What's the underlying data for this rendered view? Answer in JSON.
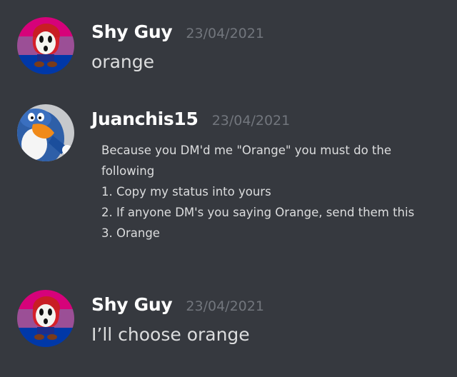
{
  "messages": [
    {
      "username": "Shy Guy",
      "timestamp": "23/04/2021",
      "text": "orange"
    },
    {
      "username": "Juanchis15",
      "timestamp": "23/04/2021",
      "lines": [
        "Because you DM'd me \"Orange\" you must do the",
        "following",
        "1. Copy my status into yours",
        "2. If anyone DM's you saying Orange, send them this",
        "3. Orange"
      ]
    },
    {
      "username": "Shy Guy",
      "timestamp": "23/04/2021",
      "text": "I’ll choose orange"
    }
  ],
  "colors": {
    "background": "#36393f",
    "username": "#ffffff",
    "timestamp": "#72767d",
    "message_text": "#dcddde"
  },
  "icons": {
    "shy_guy_avatar": "shy-guy-avatar-icon",
    "penguin_avatar": "penguin-avatar-icon"
  }
}
